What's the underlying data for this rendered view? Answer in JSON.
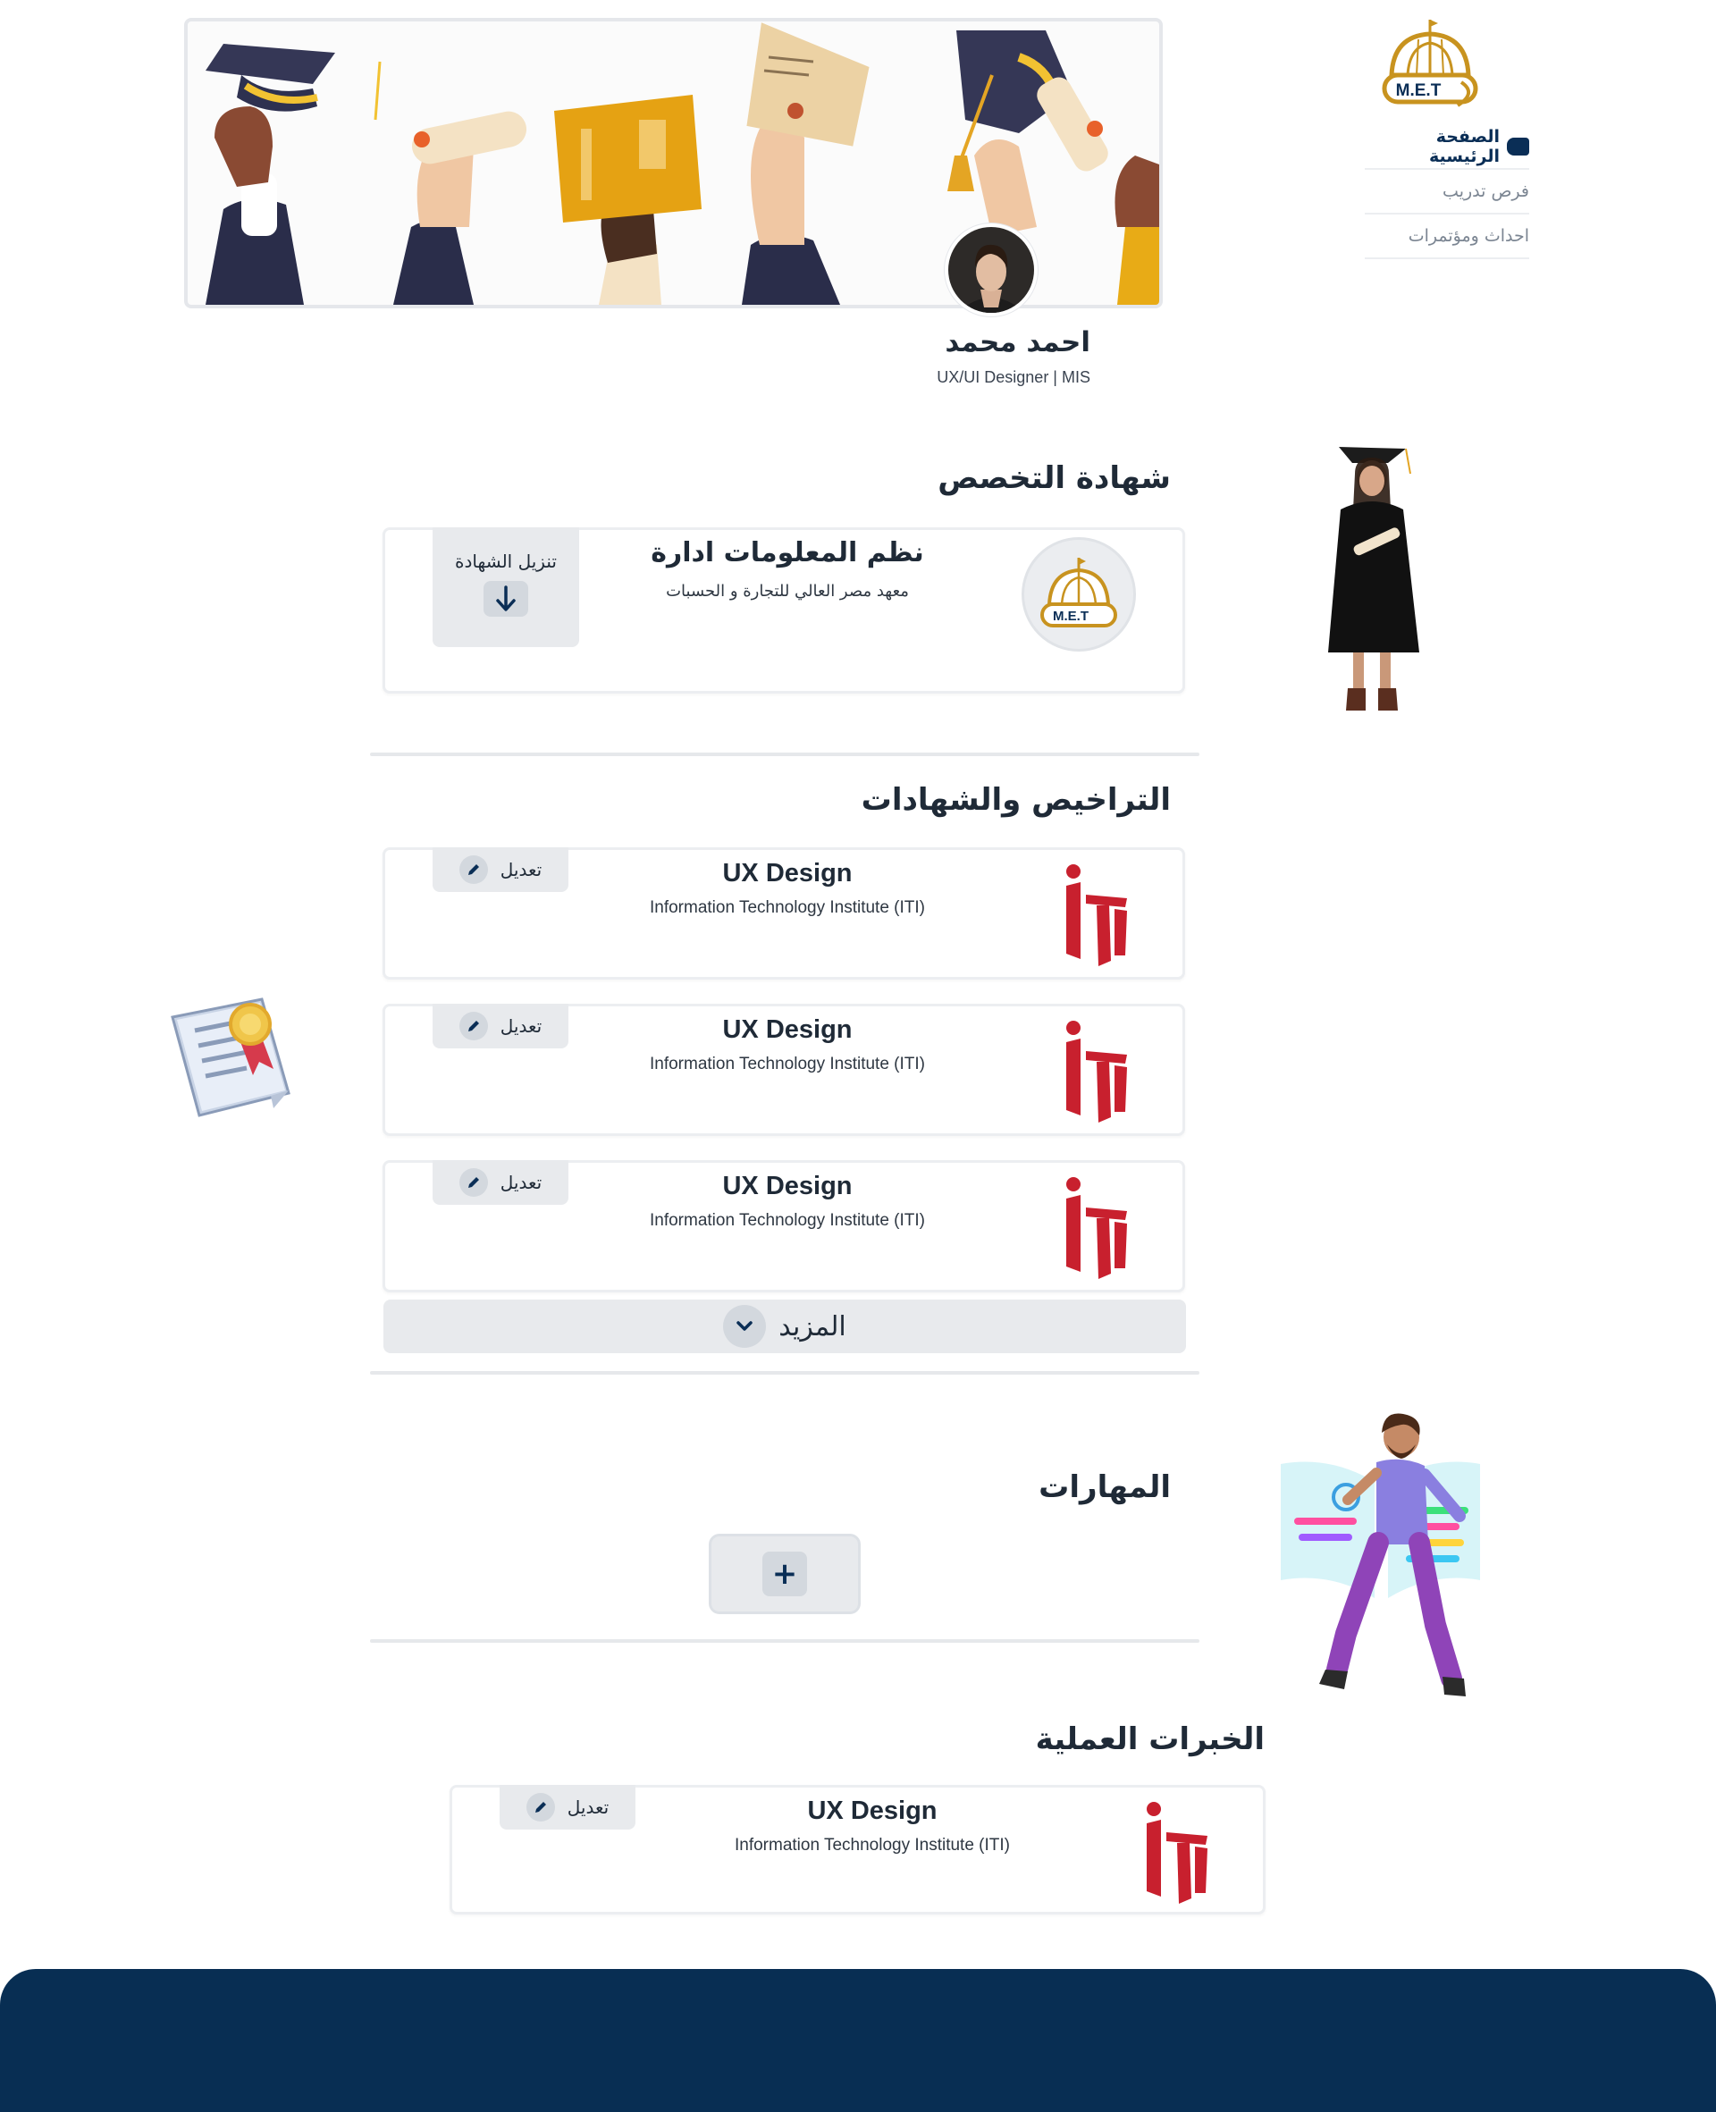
{
  "sidebar": {
    "logo_text": "M.E.T",
    "items": [
      {
        "label": "الصفحة الرئيسية",
        "active": true
      },
      {
        "label": "فرص تدريب",
        "active": false
      },
      {
        "label": "احداث ومؤتمرات",
        "active": false
      }
    ]
  },
  "profile": {
    "name": "احمد محمد",
    "role": "UX/UI Designer | MIS"
  },
  "specialization": {
    "title": "شهادة التخصص",
    "degree": "نظم المعلومات ادارة",
    "institute": "معهد مصر العالي للتجارة و الحسبات",
    "logo_text": "M.E.T",
    "download_label": "تنزيل الشهادة"
  },
  "licenses": {
    "title": "التراخيص والشهادات",
    "items": [
      {
        "title": "UX Design",
        "org": "Information Technology Institute (ITI)",
        "edit_label": "تعديل"
      },
      {
        "title": "UX Design",
        "org": "Information Technology Institute (ITI)",
        "edit_label": "تعديل"
      },
      {
        "title": "UX Design",
        "org": "Information Technology Institute (ITI)",
        "edit_label": "تعديل"
      }
    ],
    "more_label": "المزيد"
  },
  "skills": {
    "title": "المهارات",
    "add_symbol": "+"
  },
  "experience": {
    "title": "الخبرات العملية",
    "items": [
      {
        "title": "UX Design",
        "org": "Information Technology Institute (ITI)",
        "edit_label": "تعديل"
      }
    ]
  },
  "colors": {
    "primary": "#0a2e56",
    "footer": "#082e53",
    "gold": "#c8931f",
    "iti_red": "#c8202e",
    "button_bg": "#e8eaed"
  }
}
